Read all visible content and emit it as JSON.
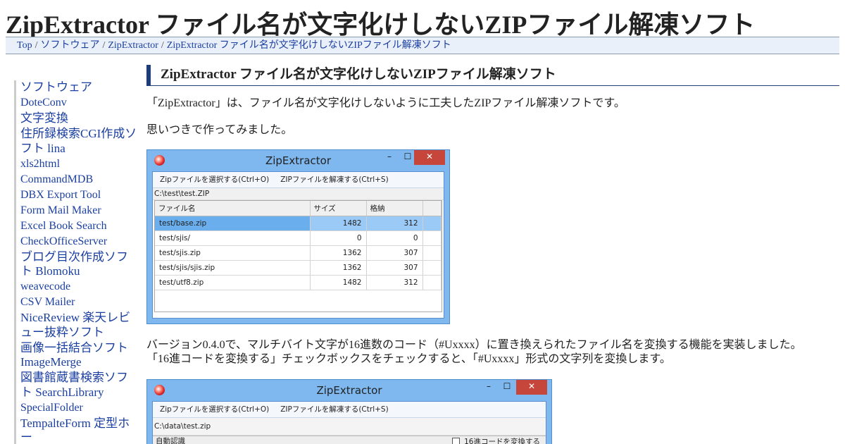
{
  "page": {
    "title": "ZipExtractor ファイル名が文字化けしないZIPファイル解凍ソフト"
  },
  "breadcrumb": [
    "Top",
    "ソフトウェア",
    "ZipExtractor",
    "ZipExtractor ファイル名が文字化けしないZIPファイル解凍ソフト"
  ],
  "sidebar": {
    "items": [
      "ソフトウェア",
      "DoteConv",
      "文字変換",
      "住所録検索CGI作成ソフト lina",
      "xls2html",
      "CommandMDB",
      "DBX Export Tool",
      "Form Mail Maker",
      "Excel Book Search",
      "CheckOfficeServer",
      "ブログ目次作成ソフト Blomoku",
      "weavecode",
      "CSV Mailer",
      "NiceReview 楽天レビュー抜粋ソフト",
      "画像一括結合ソフト ImageMerge",
      "図書館蔵書検索ソフト SearchLibrary",
      "SpecialFolder",
      "TempalteForm 定型ホー"
    ]
  },
  "article": {
    "heading": "ZipExtractor ファイル名が文字化けしないZIPファイル解凍ソフト",
    "p1": "「ZipExtractor」は、ファイル名が文字化けしないように工夫したZIPファイル解凍ソフトです。",
    "p2": "思いつきで作ってみました。",
    "p3": "バージョン0.4.0で、マルチバイト文字が16進数のコード（#Uxxxx）に置き換えられたファイル名を変換する機能を実装しました。",
    "p4": "「16進コードを変換する」チェックボックスをチェックすると、「#Uxxxx」形式の文字列を変換します。"
  },
  "screenshot1": {
    "window_title": "ZipExtractor",
    "minimize": "–",
    "maximize": "☐",
    "close": "✕",
    "menu": [
      "Zipファイルを選択する(Ctrl+O)",
      "ZIPファイルを解凍する(Ctrl+S)"
    ],
    "path": "C:\\test\\test.ZIP",
    "columns": [
      "ファイル名",
      "サイズ",
      "格納",
      ""
    ],
    "rows": [
      [
        "test/base.zip",
        "1482",
        "312"
      ],
      [
        "test/sjis/",
        "0",
        "0"
      ],
      [
        "test/sjis.zip",
        "1362",
        "307"
      ],
      [
        "test/sjis/sjis.zip",
        "1362",
        "307"
      ],
      [
        "test/utf8.zip",
        "1482",
        "312"
      ]
    ]
  },
  "screenshot2": {
    "window_title": "ZipExtractor",
    "minimize": "–",
    "maximize": "☐",
    "close": "✕",
    "menu": [
      "Zipファイルを選択する(Ctrl+O)",
      "ZIPファイルを解凍する(Ctrl+S)"
    ],
    "path": "C:\\data\\test.zip",
    "encoding": "自動認識",
    "checkbox_label": "16進コードを変換する"
  },
  "colors": {
    "link": "#1a3fa0",
    "window_frame": "#7fb8ee",
    "close_button": "#c7463c",
    "heading_bar": "#1d3c78"
  }
}
